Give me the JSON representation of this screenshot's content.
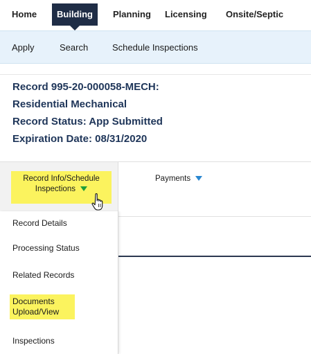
{
  "nav": {
    "items": [
      {
        "label": "Home",
        "active": false
      },
      {
        "label": "Building",
        "active": true
      },
      {
        "label": "Planning",
        "active": false
      },
      {
        "label": "Licensing",
        "active": false
      },
      {
        "label": "Onsite/Septic",
        "active": false
      }
    ]
  },
  "subnav": {
    "items": [
      "Apply",
      "Search",
      "Schedule Inspections"
    ]
  },
  "record": {
    "number": "Record 995-20-000058-MECH:",
    "type": "Residential Mechanical",
    "status": "Record Status: App Submitted",
    "expiration": "Expiration Date: 08/31/2020"
  },
  "tabs": {
    "record_info_line1": "Record Info/Schedule",
    "record_info_line2": "Inspections",
    "payments": "Payments"
  },
  "dropdown": {
    "items": [
      {
        "label": "Record Details"
      },
      {
        "label": "Processing Status"
      },
      {
        "label": "Related Records"
      },
      {
        "label": "Documents Upload/View",
        "highlighted": true
      },
      {
        "label": "Inspections"
      }
    ]
  },
  "colors": {
    "nav_active_bg": "#1f2d46",
    "subnav_bg": "#e7f2fb",
    "record_text": "#1e3559",
    "highlight": "#fbf35e",
    "dropdown_caret": "#1e9e3a",
    "payments_caret": "#2a87d0"
  },
  "icons": {
    "cursor": "hand-pointer-icon"
  }
}
